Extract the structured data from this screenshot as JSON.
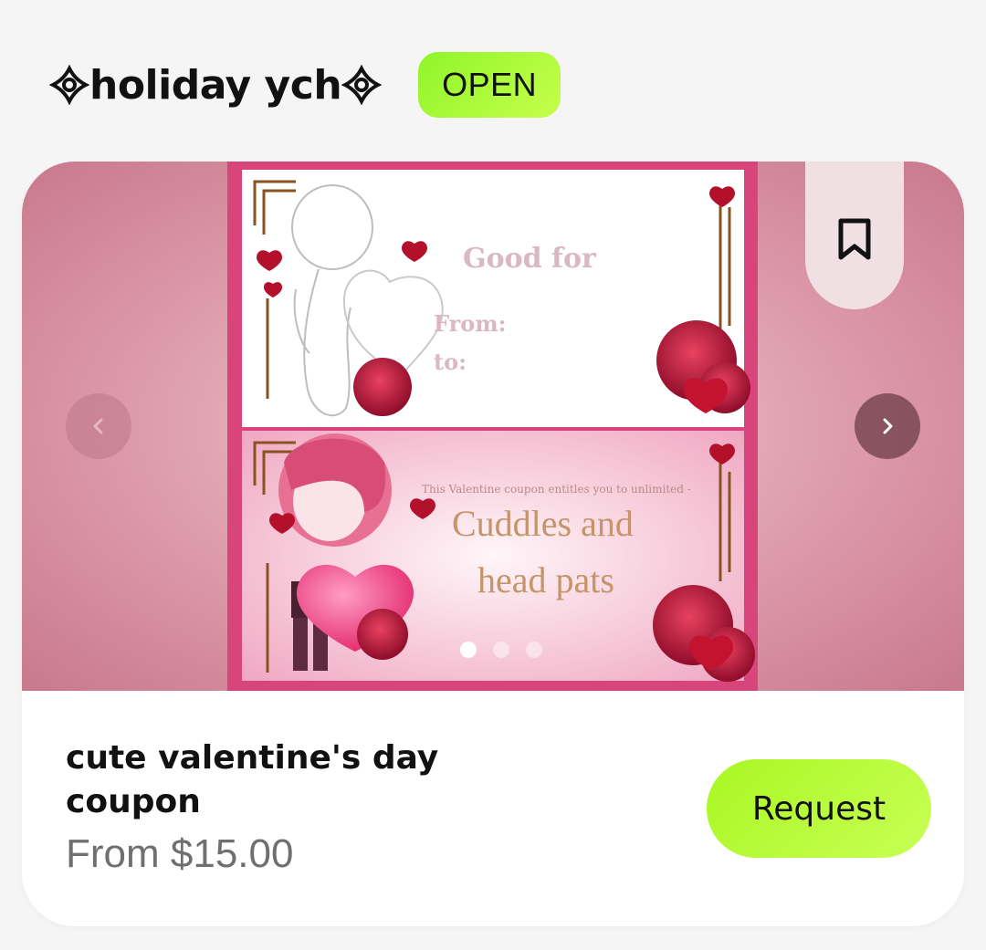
{
  "section": {
    "title": "holiday ych",
    "status": "OPEN"
  },
  "gallery": {
    "slide_count": 3,
    "active_index": 0,
    "coupon_top": {
      "good_for": "Good for",
      "from": "From:",
      "to": "to:"
    },
    "coupon_bottom": {
      "entitles": "This Valentine coupon entitles you to unlimited -",
      "line1": "Cuddles and",
      "line2": "head pats"
    },
    "icons": {
      "prev": "chevron-left-icon",
      "next": "chevron-right-icon",
      "bookmark": "bookmark-icon"
    }
  },
  "product": {
    "title": "cute valentine's day coupon",
    "price": "From $15.00",
    "request_label": "Request"
  },
  "colors": {
    "accent_green": "#b5fb35",
    "card_pink": "#d98fa1",
    "coupon_frame": "#d8457a"
  }
}
